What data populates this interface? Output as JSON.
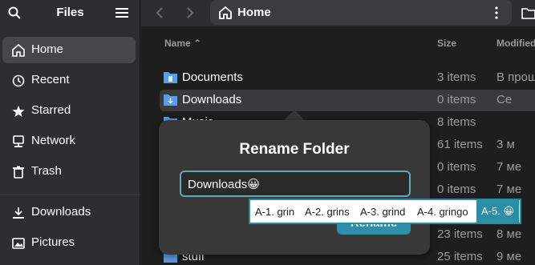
{
  "sidebar": {
    "title": "Files",
    "items": [
      {
        "label": "Home",
        "icon": "home-icon"
      },
      {
        "label": "Recent",
        "icon": "clock-icon"
      },
      {
        "label": "Starred",
        "icon": "star-icon"
      },
      {
        "label": "Network",
        "icon": "network-icon"
      },
      {
        "label": "Trash",
        "icon": "trash-icon"
      },
      {
        "label": "Downloads",
        "icon": "download-icon"
      },
      {
        "label": "Pictures",
        "icon": "picture-icon"
      }
    ]
  },
  "header": {
    "path": "Home"
  },
  "columns": {
    "name": "Name",
    "size": "Size",
    "modified": "Modified"
  },
  "rows": [
    {
      "name": "Documents",
      "size": "3 items",
      "modified": "В прош"
    },
    {
      "name": "Downloads",
      "size": "0 items",
      "modified": "Се"
    },
    {
      "name": "Music",
      "size": "8 items",
      "modified": ""
    },
    {
      "name": "",
      "size": "61 items",
      "modified": "3 м"
    },
    {
      "name": "",
      "size": "0 items",
      "modified": "7 ме"
    },
    {
      "name": "",
      "size": "0 items",
      "modified": "7 ме"
    },
    {
      "name": "",
      "size": "",
      "modified": ""
    },
    {
      "name": "",
      "size": "23 items",
      "modified": "8 ме"
    },
    {
      "name": "stuff",
      "size": "25 items",
      "modified": "9 ме"
    }
  ],
  "dialog": {
    "title": "Rename Folder",
    "input_value": "Downloads😀",
    "button": "Rename"
  },
  "emoji_candidates": [
    {
      "label": "A-1. grin"
    },
    {
      "label": "A-2. grins"
    },
    {
      "label": "A-3. grind"
    },
    {
      "label": "A-4. gringo"
    },
    {
      "label": "A-5. 😀"
    }
  ],
  "colors": {
    "accent": "#2f8fa8",
    "folder": "#5c9ee6"
  }
}
